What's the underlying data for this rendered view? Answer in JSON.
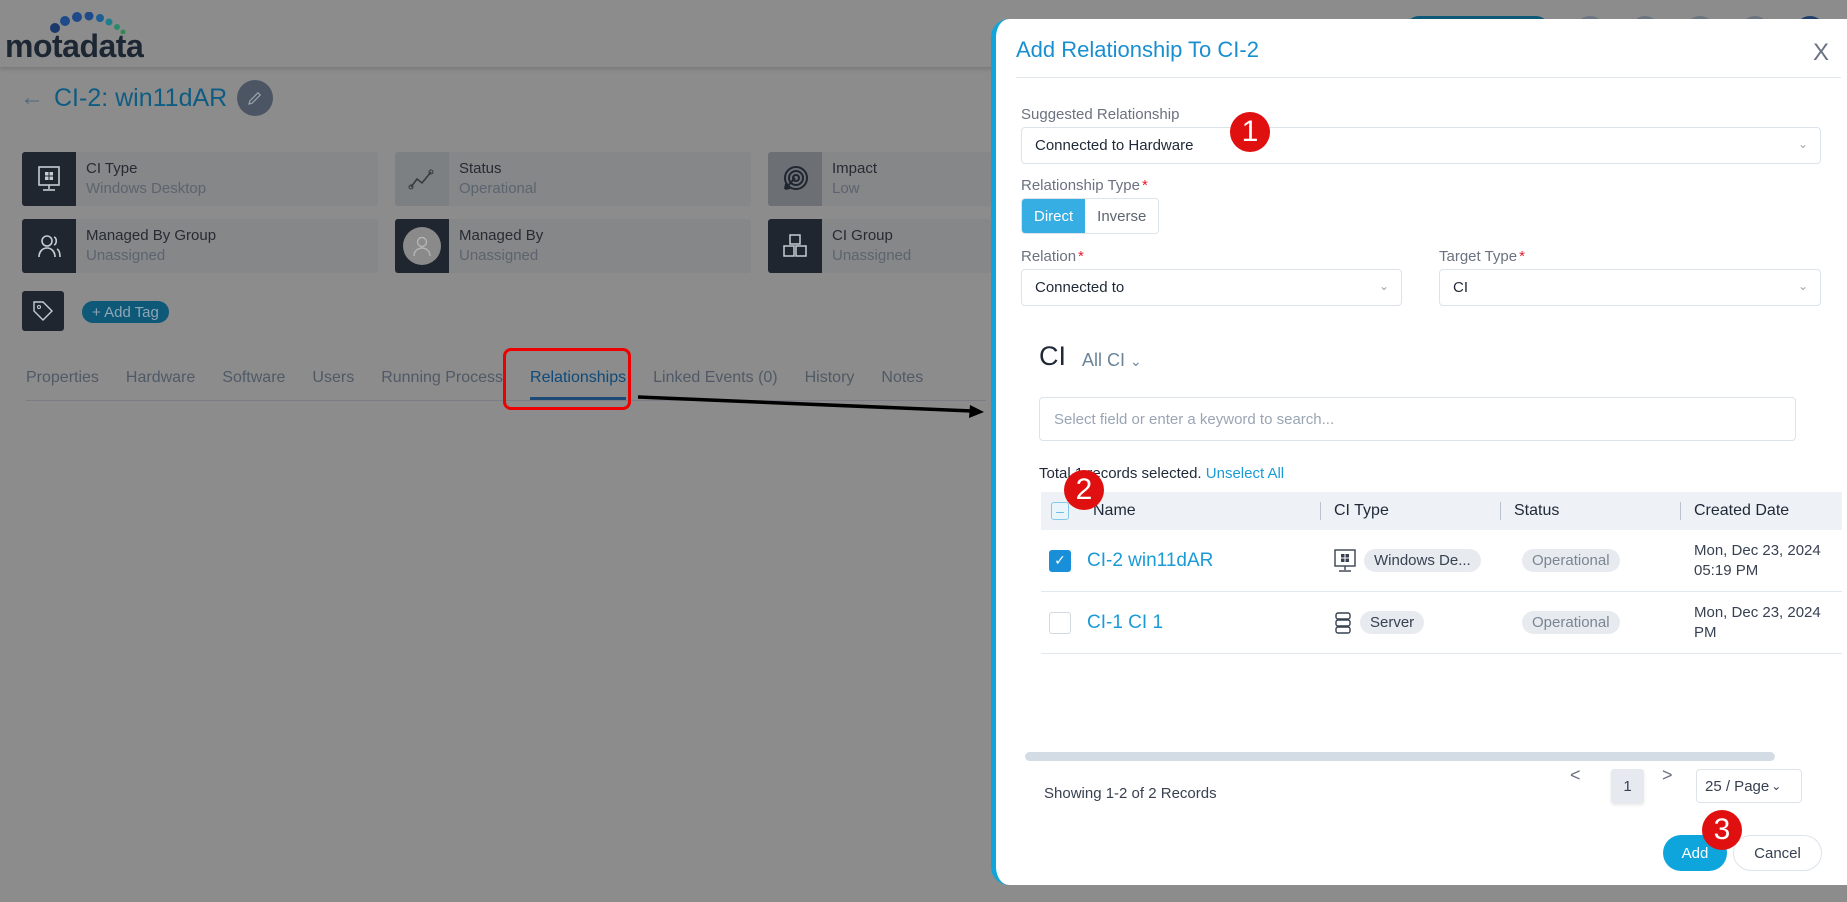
{
  "app": {
    "logo_text": "motadata"
  },
  "ci": {
    "back_icon": "arrow-left-icon",
    "title": "CI-2: win11dAR",
    "edit_icon": "pencil-icon"
  },
  "info_cards": [
    {
      "label": "CI Type",
      "value": "Windows Desktop",
      "icon": "windows-desktop-icon"
    },
    {
      "label": "Status",
      "value": "Operational",
      "icon": "status-trend-icon"
    },
    {
      "label": "Impact",
      "value": "Low",
      "icon": "target-icon"
    },
    {
      "label": "Managed By Group",
      "value": "Unassigned",
      "icon": "users-icon"
    },
    {
      "label": "Managed By",
      "value": "Unassigned",
      "icon": "avatar-icon"
    },
    {
      "label": "CI Group",
      "value": "Unassigned",
      "icon": "cubes-icon"
    }
  ],
  "tags": {
    "icon": "tag-icon",
    "add_label": "+ Add Tag"
  },
  "tabs": [
    {
      "label": "Properties",
      "active": false
    },
    {
      "label": "Hardware",
      "active": false
    },
    {
      "label": "Software",
      "active": false
    },
    {
      "label": "Users",
      "active": false
    },
    {
      "label": "Running Process",
      "active": false
    },
    {
      "label": "Relationships",
      "active": true
    },
    {
      "label": "Linked Events (0)",
      "active": false
    },
    {
      "label": "History",
      "active": false
    },
    {
      "label": "Notes",
      "active": false
    }
  ],
  "modal": {
    "title": "Add Relationship To CI-2",
    "close_label": "X",
    "suggested_relationship": {
      "label": "Suggested Relationship",
      "value": "Connected to Hardware"
    },
    "relationship_type": {
      "label": "Relationship Type",
      "options": [
        "Direct",
        "Inverse"
      ],
      "selected": "Direct"
    },
    "relation": {
      "label": "Relation",
      "value": "Connected to"
    },
    "target_type": {
      "label": "Target Type",
      "value": "CI"
    },
    "ci_heading": "CI",
    "ci_filter": "All CI",
    "search": {
      "placeholder": "Select field or enter a keyword to search...",
      "value": ""
    },
    "selection_text": "Total 1 records selected.",
    "unselect_all": "Unselect All",
    "table": {
      "columns": [
        "Name",
        "CI Type",
        "Status",
        "Created Date"
      ],
      "rows": [
        {
          "checked": true,
          "name": "CI-2 win11dAR",
          "ci_type": "Windows De...",
          "ci_type_icon": "windows-desktop-icon",
          "status": "Operational",
          "created_line1": "Mon, Dec 23, 2024",
          "created_line2": "05:19 PM"
        },
        {
          "checked": false,
          "name": "CI-1 CI 1",
          "ci_type": "Server",
          "ci_type_icon": "server-icon",
          "status": "Operational",
          "created_line1": "Mon, Dec 23, 2024",
          "created_line2": "PM"
        }
      ]
    },
    "pagination": {
      "showing": "Showing 1-2 of 2 Records",
      "prev": "<",
      "current_page": "1",
      "next": ">",
      "page_size": "25 / Page"
    },
    "buttons": {
      "add": "Add",
      "cancel": "Cancel"
    }
  },
  "annotations": {
    "badges": [
      "1",
      "2",
      "3"
    ],
    "colors": {
      "badge": "#e01010",
      "highlight": "#ee0000",
      "accent": "#0ea5dc"
    }
  }
}
